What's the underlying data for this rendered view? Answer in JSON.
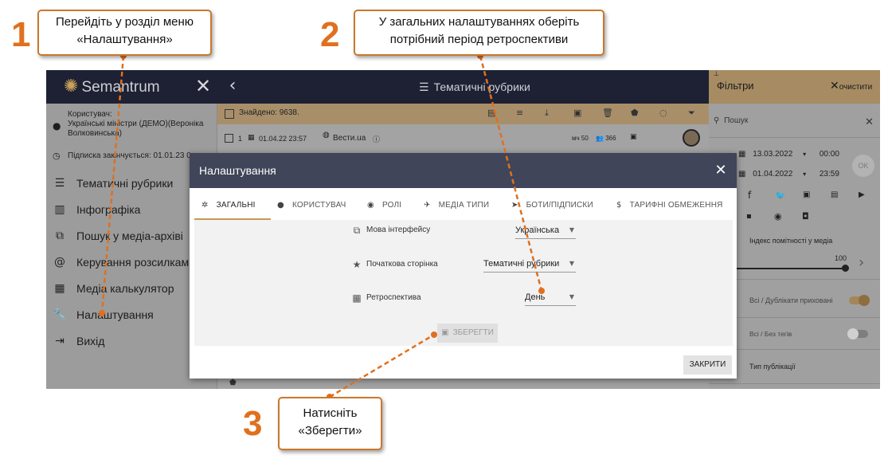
{
  "callouts": {
    "one": {
      "number": "1",
      "text": "Перейдіть у розділ меню «Налаштування»"
    },
    "two": {
      "number": "2",
      "text": "У загальних налаштуваннях оберіть потрібний період ретроспективи"
    },
    "three": {
      "number": "3",
      "text": "Натисніть «Зберегти»"
    }
  },
  "app": {
    "logo": "Semantrum",
    "title": "Тематичні рубрики",
    "user_label": "Користувач:",
    "user_name": "Українські міністри (ДЕМО)(Вероніка Волковинська)",
    "subscription": "Підписка закінчується: 01.01.23 0",
    "menu": [
      {
        "label": "Тематичні рубрики",
        "icon": "list-icon"
      },
      {
        "label": "Інфографіка",
        "icon": "infographic-icon"
      },
      {
        "label": "Пошук у медіа-архіві",
        "icon": "external-search-icon"
      },
      {
        "label": "Керування розсилками",
        "icon": "at-icon"
      },
      {
        "label": "Медіа калькулятор",
        "icon": "calculator-icon"
      },
      {
        "label": "Налаштування",
        "icon": "wrench-icon"
      },
      {
        "label": "Вихід",
        "icon": "logout-icon"
      }
    ],
    "found": "Знайдено: 9638.",
    "row": {
      "index": "1",
      "date": "01.04.22 23:57",
      "source": "Вести.ua",
      "metric1": "50",
      "metric2": "366"
    }
  },
  "filters": {
    "title": "Фільтри",
    "clear": "очистити",
    "search_placeholder": "Пошук",
    "date_from": "13.03.2022",
    "time_from": "00:00",
    "date_to": "01.04.2022",
    "time_to": "23:59",
    "ok": "OK",
    "visibility_label": "Індекс помітності у медіа",
    "visibility_value": "100",
    "duplicates": "Всі / Дублікати приховані",
    "tags": "Всі / Без тегів",
    "pub_type": "Тип публікації"
  },
  "modal": {
    "title": "Налаштування",
    "tabs": [
      {
        "label": "ЗАГАЛЬНІ",
        "icon": "gear-icon"
      },
      {
        "label": "КОРИСТУВАЧ",
        "icon": "user-icon"
      },
      {
        "label": "РОЛІ",
        "icon": "roles-icon"
      },
      {
        "label": "МЕДІА ТИПИ",
        "icon": "media-icon"
      },
      {
        "label": "БОТИ/ПІДПИСКИ",
        "icon": "send-icon"
      },
      {
        "label": "ТАРИФНІ ОБМЕЖЕННЯ",
        "icon": "dollar-icon"
      }
    ],
    "language_label": "Мова інтерфейсу",
    "language_value": "Українська",
    "start_label": "Початкова сторінка",
    "start_value": "Тематичні рубрики",
    "retro_label": "Ретроспектива",
    "retro_value": "День",
    "save": "ЗБЕРЕГТИ",
    "close": "ЗАКРИТИ"
  }
}
